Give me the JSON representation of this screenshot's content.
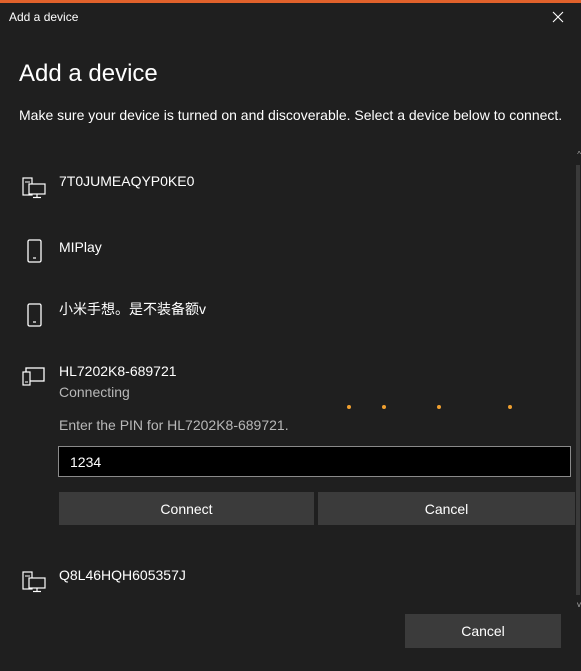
{
  "window": {
    "title": "Add a device"
  },
  "header": {
    "heading": "Add a device",
    "instructions": "Make sure your device is turned on and discoverable. Select a device below to connect."
  },
  "devices": [
    {
      "name": "7T0JUMEAQYP0KE0",
      "icon": "desktop-computer-icon"
    },
    {
      "name": "MIPlay",
      "icon": "phone-icon"
    },
    {
      "name": "小米手想。是不装备额v",
      "icon": "phone-icon"
    },
    {
      "name": "HL7202K8-689721",
      "icon": "display-icon",
      "status": "Connecting"
    },
    {
      "name": "Q8L46HQH605357J",
      "icon": "desktop-computer-icon"
    }
  ],
  "pin": {
    "label": "Enter the PIN for HL7202K8-689721.",
    "value": "1234",
    "connect_label": "Connect",
    "cancel_label": "Cancel"
  },
  "footer": {
    "cancel_label": "Cancel"
  },
  "colors": {
    "accent": "#e0612b",
    "background": "#1f1f1f",
    "button": "#3b3b3b",
    "progress_dots": "#f0a030"
  }
}
